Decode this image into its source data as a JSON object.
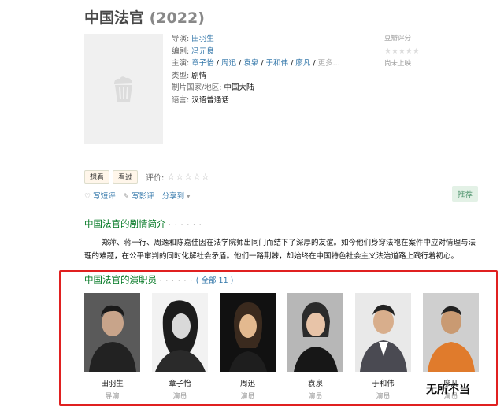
{
  "title": {
    "name": "中国法官",
    "year": "(2022)"
  },
  "info": {
    "director_label": "导演:",
    "director": "田羽生",
    "writer_label": "编剧:",
    "writer": "冯元良",
    "cast_label": "主演:",
    "cast": [
      "章子怡",
      "周迅",
      "袁泉",
      "于和伟",
      "廖凡"
    ],
    "more": "更多...",
    "genre_label": "类型:",
    "genre": "剧情",
    "country_label": "制片国家/地区:",
    "country": "中国大陆",
    "language_label": "语言:",
    "language": "汉语普通话"
  },
  "rating": {
    "label": "豆瓣评分",
    "stars": "★★★★★",
    "status": "尚未上映"
  },
  "actions": {
    "want": "想看",
    "seen": "看过",
    "rate_label": "评价:",
    "rate_stars": "☆☆☆☆☆"
  },
  "social": {
    "short_review": "写短评",
    "review": "写影评",
    "share": "分享到",
    "share_arrow": "▾"
  },
  "recommend": "推荐",
  "synopsis": {
    "heading": "中国法官的剧情简介",
    "dots": "· · · · · ·",
    "text": "郑萍、蒋一行、周逸和陈嘉佳因在法学院师出同门而结下了深厚的友谊。如今他们身穿法袍在案件中应对情理与法理的难题，在公平审判的同时化解社会矛盾。他们一路荆棘，却始终在中国特色社会主义法治道路上践行着初心。"
  },
  "cast_section": {
    "heading": "中国法官的演职员",
    "dots": "· · · · · ·",
    "all": "( 全部 11 )",
    "members": [
      {
        "name": "田羽生",
        "role": "导演"
      },
      {
        "name": "章子怡",
        "role": "演员"
      },
      {
        "name": "周迅",
        "role": "演员"
      },
      {
        "name": "袁泉",
        "role": "演员"
      },
      {
        "name": "于和伟",
        "role": "演员"
      },
      {
        "name": "廖凡",
        "role": "演员"
      }
    ]
  },
  "watermark": "无所不当",
  "colors": {
    "link": "#3377aa",
    "section_green": "#007722",
    "highlight_box": "#e02020",
    "recommend_bg": "#e3f1e6"
  }
}
